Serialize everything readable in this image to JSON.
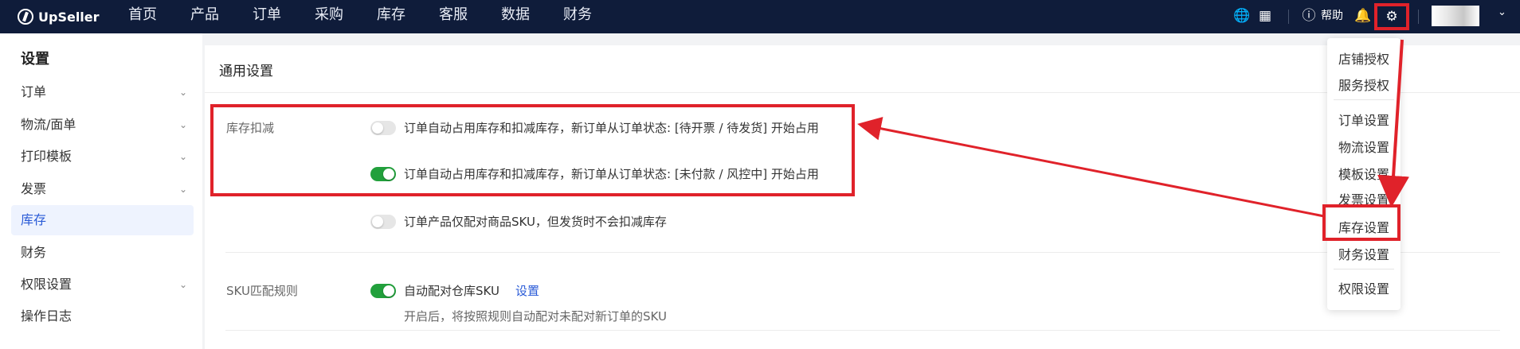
{
  "app": {
    "logo_text": "UpSeller"
  },
  "nav": [
    "首页",
    "产品",
    "订单",
    "采购",
    "库存",
    "客服",
    "数据",
    "财务"
  ],
  "topbar": {
    "help_label": "帮助"
  },
  "sidebar": {
    "title": "设置",
    "items": [
      {
        "label": "订单",
        "expandable": true
      },
      {
        "label": "物流/面单",
        "expandable": true
      },
      {
        "label": "打印模板",
        "expandable": true
      },
      {
        "label": "发票",
        "expandable": true
      },
      {
        "label": "库存",
        "expandable": false,
        "active": true
      },
      {
        "label": "财务",
        "expandable": false
      },
      {
        "label": "权限设置",
        "expandable": true
      },
      {
        "label": "操作日志",
        "expandable": false
      }
    ]
  },
  "main": {
    "title": "通用设置",
    "inventory": {
      "label": "库存扣减",
      "options": [
        {
          "text": "订单自动占用库存和扣减库存，新订单从订单状态: [待开票 / 待发货] 开始占用",
          "on": false
        },
        {
          "text": "订单自动占用库存和扣减库存，新订单从订单状态: [未付款 / 风控中] 开始占用",
          "on": true
        },
        {
          "text": "订单产品仅配对商品SKU，但发货时不会扣减库存",
          "on": false
        }
      ]
    },
    "sku": {
      "label": "SKU匹配规则",
      "option_text": "自动配对仓库SKU",
      "option_on": true,
      "link": "设置",
      "hint": "开启后，将按照规则自动配对未配对新订单的SKU"
    }
  },
  "dropdown": {
    "items": [
      "店铺授权",
      "服务授权",
      "订单设置",
      "物流设置",
      "模板设置",
      "发票设置",
      "库存设置",
      "财务设置",
      "权限设置"
    ]
  },
  "colors": {
    "topbar": "#0f1c3a",
    "accent": "#2a5bd7",
    "toggle_on": "#22a03c",
    "highlight": "#e0222a"
  }
}
